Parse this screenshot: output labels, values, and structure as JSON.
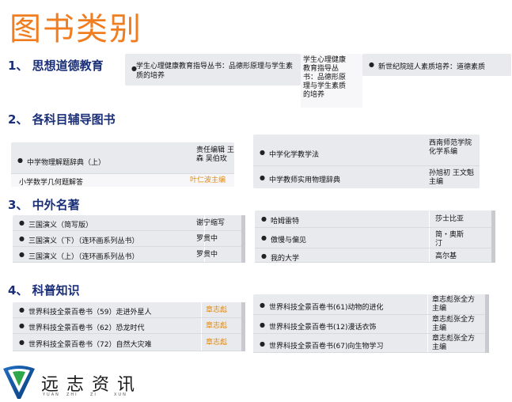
{
  "title": "图书类别",
  "sections": [
    {
      "heading": "1、 思想道德教育",
      "panels": [
        {
          "rows": [
            {
              "name": "学生心理健康教育指导丛书：品德形原理与学生素质的培养"
            }
          ]
        },
        {
          "rows": [
            {
              "name": "学生心理健康教育指导丛书：品德形原理与学生素质的培养"
            }
          ]
        },
        {
          "rows": [
            {
              "name": "新世纪院班人素质培养：道德素质"
            }
          ]
        }
      ]
    },
    {
      "heading": "2、 各科目辅导图书",
      "panels": [
        {
          "rows": [
            {
              "name": "中学物理解题辞典（上）",
              "author": "责任编辑 王森 吴伯玫"
            },
            {
              "name": "小学数学几何题解答",
              "author": "叶仁波主编"
            }
          ]
        },
        {
          "rows": [
            {
              "name": "中学化学教学法",
              "author": "西南师范学院化学系编"
            },
            {
              "name": "中学教师实用物理辞典",
              "author": "孙旭初 王文魁主编"
            }
          ]
        }
      ]
    },
    {
      "heading": "3、 中外名著",
      "panels": [
        {
          "rows": [
            {
              "name": "三国演义（简写版）",
              "author": "谢宁缩写"
            },
            {
              "name": "三国演义（下）（连环画系列丛书）",
              "author": "罗贯中"
            },
            {
              "name": "三国演义（上）（连环画系列丛书）",
              "author": "罗贯中"
            }
          ]
        },
        {
          "rows": [
            {
              "name": "哈姆雷特",
              "author": "莎士比亚"
            },
            {
              "name": "傲慢与偏见",
              "author": "简・奥斯汀"
            },
            {
              "name": "我的大学",
              "author": "高尔基"
            }
          ]
        }
      ]
    },
    {
      "heading": "4、 科普知识",
      "panels": [
        {
          "rows": [
            {
              "name": "世界科技全景百卷书（59）走进外星人",
              "author": "章志彪",
              "more": "..."
            },
            {
              "name": "世界科技全景百卷书（62）恐龙时代",
              "author": "章志彪",
              "more": "..."
            },
            {
              "name": "世界科技全景百卷书（72）自然大灾难",
              "author": "章志彪",
              "more": "..."
            }
          ]
        },
        {
          "rows": [
            {
              "name": "世界科技全景百卷书(61)动物的进化",
              "author": "章志彪张全方主编"
            },
            {
              "name": "世界科技全景百卷书(12)漫话衣饰",
              "author": "章志彪张全方主编"
            },
            {
              "name": "世界科技全景百卷书(67)向生物学习",
              "author": "章志彪张全方主编"
            }
          ]
        }
      ]
    }
  ],
  "logo": {
    "text": "远志资讯",
    "sub": [
      "YUAN",
      "ZHI",
      "ZI",
      "XUN"
    ]
  },
  "colors": {
    "title": "#f07d20",
    "heading": "#1a2f78",
    "accent": "#e38a0a"
  }
}
